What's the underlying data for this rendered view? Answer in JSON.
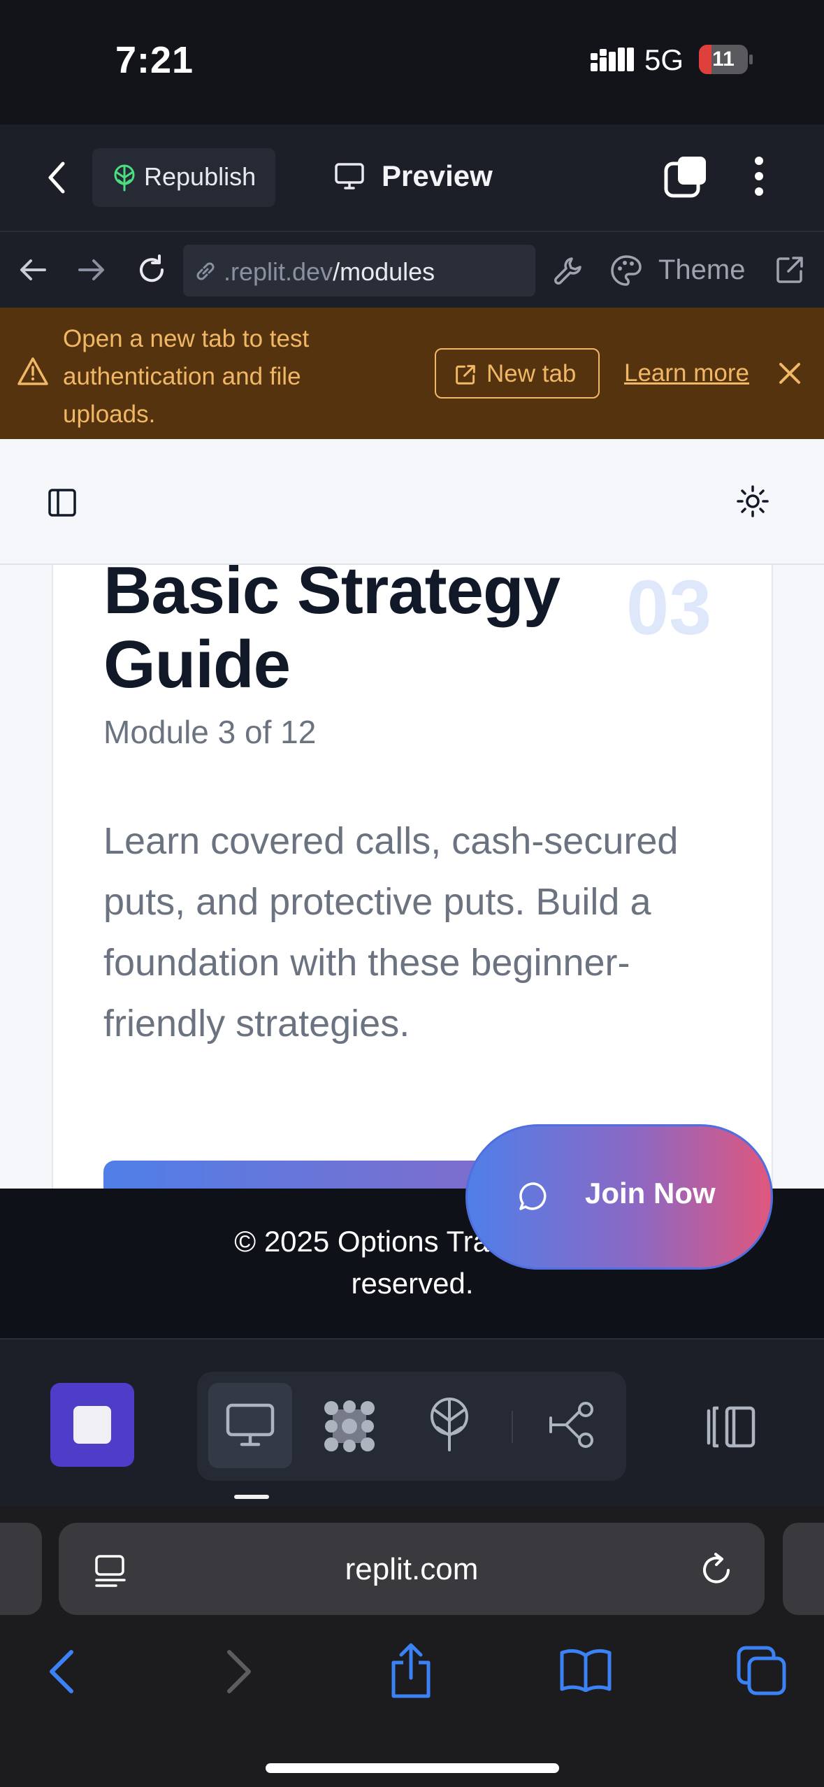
{
  "status_bar": {
    "time": "7:21",
    "network": "5G",
    "battery_level": "11",
    "battery_color": "#e0403c"
  },
  "app_toolbar": {
    "republish_label": "Republish",
    "preview_label": "Preview"
  },
  "url_toolbar": {
    "url_domain": ".replit.dev",
    "url_path": "/modules",
    "theme_label": "Theme"
  },
  "banner": {
    "text": "Open a new tab to test authentication and file uploads.",
    "new_tab_label": "New tab",
    "learn_more_label": "Learn more",
    "accent_color": "#f0b866"
  },
  "module_card": {
    "number": "03",
    "title": "Basic Strategy Guide",
    "progress": "Module 3 of 12",
    "description": "Learn covered calls, cash-secured puts, and protective puts. Build a foundation with these beginner-friendly strategies."
  },
  "footer": {
    "text": "© 2025 Options Trading Un",
    "text_line2": "reserved."
  },
  "cta": {
    "label": "Join Now"
  },
  "dock": {
    "icons": [
      "stop-icon",
      "monitor-icon",
      "apps-icon",
      "deploy-icon",
      "git-icon",
      "layout-icon"
    ],
    "stop_color": "#4e3dc8"
  },
  "safari": {
    "domain": "replit.com"
  }
}
